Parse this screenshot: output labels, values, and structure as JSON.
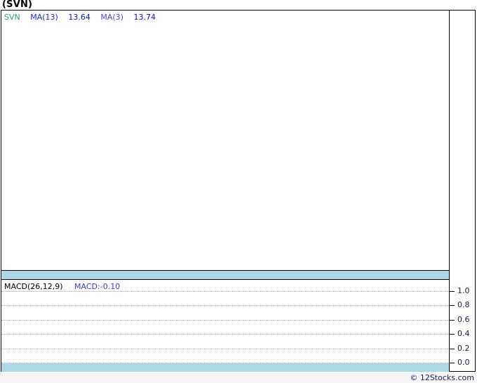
{
  "page": {
    "title": "(SVN)",
    "copyright": "© 12Stocks.com"
  },
  "colors": {
    "band": "#ADD8E6",
    "symbol": "#2E9E60",
    "ma1": "#2424CC",
    "ma2": "#4B43D0",
    "value": "#0B0BDF",
    "macd_label": "#000000",
    "macd_value": "#3B3BD0",
    "axis_label": "#1B1B40"
  },
  "main_chart": {
    "legend": {
      "symbol": "SVN",
      "ma1_label": "MA(13)",
      "ma1_value": "13.64",
      "ma2_label": "MA(3)",
      "ma2_value": "13.74"
    }
  },
  "macd_chart": {
    "legend": {
      "label": "MACD(26,12,9)",
      "value": "MACD:-0.10"
    },
    "y_axis": [
      "1.0",
      "0.8",
      "0.6",
      "0.4",
      "0.2",
      "0.0"
    ]
  },
  "chart_data": [
    {
      "type": "line",
      "panel": "price",
      "title": "(SVN)",
      "series": [
        {
          "name": "SVN",
          "color": "#2E9E60",
          "values": []
        },
        {
          "name": "MA(13)",
          "color": "#2424CC",
          "last_value": 13.64,
          "values": []
        },
        {
          "name": "MA(3)",
          "color": "#4B43D0",
          "last_value": 13.74,
          "values": []
        }
      ],
      "legend_position": "top-left",
      "grid": false
    },
    {
      "type": "line",
      "panel": "indicator",
      "title": "MACD(26,12,9)",
      "series": [
        {
          "name": "MACD",
          "last_value": -0.1,
          "values": []
        }
      ],
      "yticks": [
        1.0,
        0.8,
        0.6,
        0.4,
        0.2,
        0.0
      ],
      "ylim": [
        -0.12,
        1.12
      ],
      "y_axis_side": "right",
      "grid": true,
      "legend_position": "top-left"
    }
  ]
}
